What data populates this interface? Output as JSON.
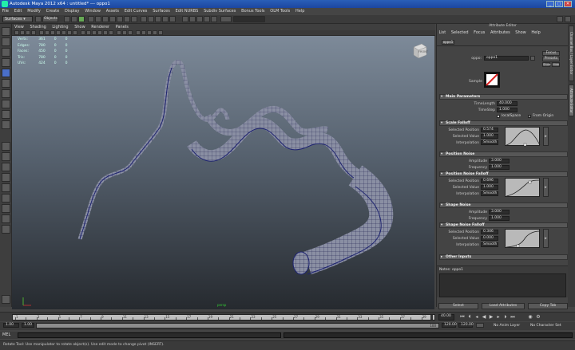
{
  "window": {
    "title": "Autodesk Maya 2012 x64 : untitled*    ---    oppo1",
    "min": "_",
    "max": "▢",
    "close": "✕"
  },
  "menubar": [
    "File",
    "Edit",
    "Modify",
    "Create",
    "Display",
    "Window",
    "Assets",
    "Edit Curves",
    "Surfaces",
    "Edit NURBS",
    "Subdiv Surfaces",
    "Bonus Tools",
    "OLM Tools",
    "Help"
  ],
  "shelf": {
    "menuset": "Surfaces",
    "objects_label": "Objects"
  },
  "panel_menu": [
    "View",
    "Shading",
    "Lighting",
    "Show",
    "Renderer",
    "Panels"
  ],
  "hud": {
    "rows": [
      {
        "label": "Verts:",
        "a": "361",
        "b": "0",
        "c": "0"
      },
      {
        "label": "Edges:",
        "a": "780",
        "b": "0",
        "c": "0"
      },
      {
        "label": "Faces:",
        "a": "450",
        "b": "0",
        "c": "0"
      },
      {
        "label": "Tris:",
        "a": "780",
        "b": "0",
        "c": "0"
      },
      {
        "label": "UVs:",
        "a": "424",
        "b": "0",
        "c": "0"
      }
    ]
  },
  "viewcube_label": "FRONT",
  "persp_label": "persp",
  "attribute_editor": {
    "title": "Attribute Editor",
    "menu": [
      "List",
      "Selected",
      "Focus",
      "Attributes",
      "Show",
      "Help"
    ],
    "tab": "oppo1",
    "node_label": "oppo:",
    "node_value": "oppo1",
    "focus_btn": "Focus",
    "presets_btn": "Presets",
    "show_btn": "Show",
    "hide_btn": "Hide",
    "sample_label": "Sample",
    "sections": {
      "main": "Main Parameters",
      "scale": "Scale Falloff",
      "position_noise": "Position Noise",
      "position_falloff": "Position Noise Falloff",
      "shape_noise": "Shape Noise",
      "shape_falloff": "Shape Noise Falloff",
      "other": "Other Inputs"
    },
    "main_params": {
      "time_length_label": "TimeLength",
      "time_length": "40.000",
      "time_step_label": "TimeStep",
      "time_step": "1.000",
      "local_space_label": "localSpace",
      "from_origin_label": "From Origin"
    },
    "scale_falloff": {
      "pos_label": "Selected Position",
      "pos": "0.574",
      "val_label": "Selected Value",
      "val": "1.000",
      "interp_label": "Interpolation",
      "interp": "Smooth"
    },
    "position_noise": {
      "amp_label": "Amplitude",
      "amp": "3.000",
      "freq_label": "Frequency",
      "freq": "1.000"
    },
    "position_falloff": {
      "pos_label": "Selected Position",
      "pos": "0.696",
      "val_label": "Selected Value",
      "val": "1.000",
      "interp_label": "Interpolation",
      "interp": "Smooth"
    },
    "shape_noise": {
      "amp_label": "Amplitude",
      "amp": "3.000",
      "freq_label": "Frequency",
      "freq": "1.000"
    },
    "shape_falloff": {
      "pos_label": "Selected Position",
      "pos": "0.346",
      "val_label": "Selected Value",
      "val": "0.000",
      "interp_label": "Interpolation",
      "interp": "Smooth"
    },
    "notes_label": "Notes: oppo1",
    "buttons": {
      "select": "Select",
      "load": "Load Attributes",
      "copy": "Copy Tab"
    }
  },
  "side_tabs": [
    "Channel Box / Layer Editor",
    "Attribute Editor"
  ],
  "timeline": {
    "ticks": [
      "1",
      "2",
      "3",
      "4",
      "5",
      "6",
      "7",
      "8",
      "9",
      "10",
      "11",
      "12",
      "13",
      "14",
      "15",
      "16",
      "17",
      "18",
      "19",
      "20",
      "21",
      "22",
      "23",
      "24",
      "25",
      "26",
      "27",
      "28",
      "29",
      "30",
      "31",
      "32",
      "33",
      "34",
      "35",
      "36",
      "37",
      "38",
      "39",
      "40"
    ],
    "current_frame": "40.00"
  },
  "range": {
    "start": "1.00",
    "inner_start": "1.00",
    "inner_end": "100",
    "end": "120.00",
    "max": "120.00",
    "anim_layer": "No Anim Layer",
    "char_set": "No Character Set"
  },
  "command": {
    "label": "MEL"
  },
  "helpline": "Rotate Tool: Use manipulator to rotate object(s). Use edit mode to change pivot (INSERT)."
}
